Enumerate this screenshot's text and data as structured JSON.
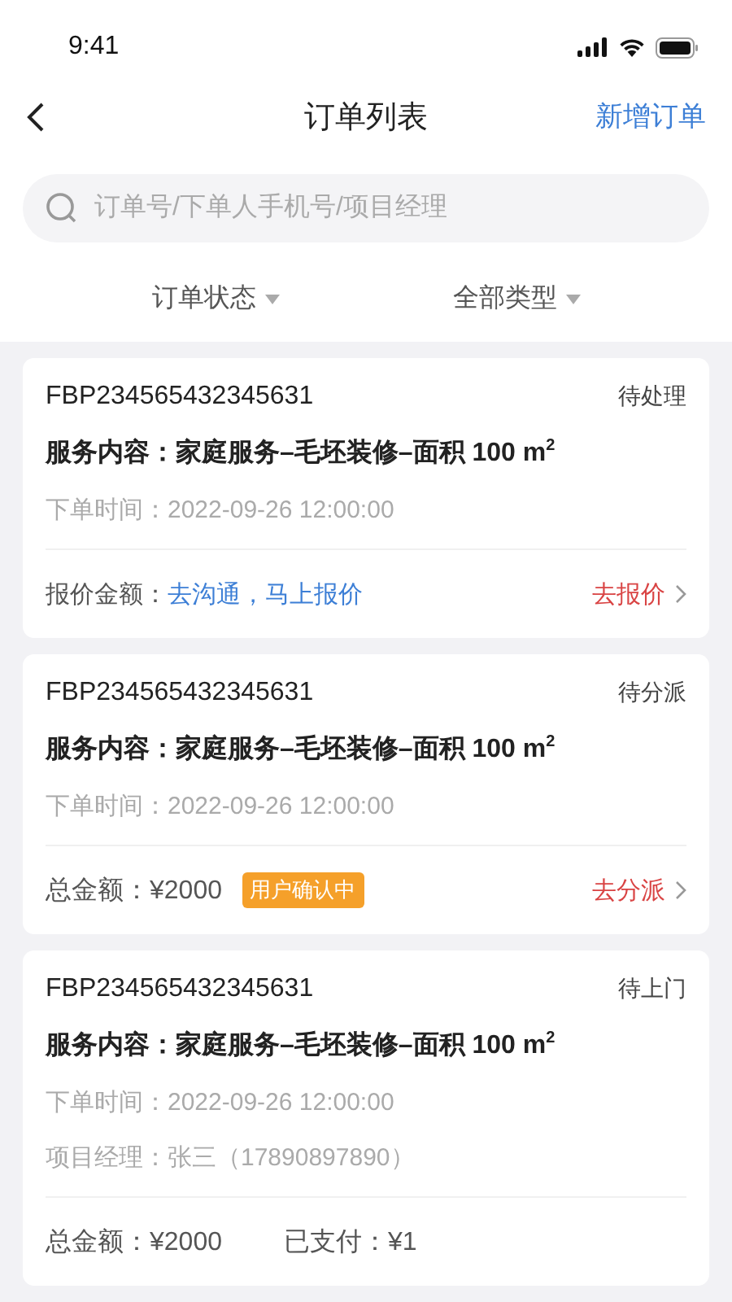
{
  "status_bar": {
    "time": "9:41"
  },
  "nav": {
    "title": "订单列表",
    "action": "新增订单"
  },
  "search": {
    "placeholder": "订单号/下单人手机号/项目经理"
  },
  "filters": [
    {
      "label": "订单状态"
    },
    {
      "label": "全部类型"
    }
  ],
  "orders": [
    {
      "number": "FBP234565432345631",
      "status": "待处理",
      "service": "服务内容：家庭服务–毛坯装修–面积 100 m$^{2}$",
      "details": [
        "下单时间：2022-09-26 12:00:00"
      ],
      "footer": [
        {
          "kind": "label",
          "text": "报价金额："
        },
        {
          "kind": "link",
          "text": "去沟通，马上报价"
        },
        {
          "kind": "action",
          "text": "去报价"
        }
      ]
    },
    {
      "number": "FBP234565432345631",
      "status": "待分派",
      "service": "服务内容：家庭服务–毛坯装修–面积 100 m$^{2}$",
      "details": [
        "下单时间：2022-09-26 12:00:00"
      ],
      "footer": [
        {
          "kind": "amount",
          "text": "总金额：¥2000"
        },
        {
          "kind": "badge",
          "text": "用户确认中"
        },
        {
          "kind": "action",
          "text": "去分派"
        }
      ]
    },
    {
      "number": "FBP234565432345631",
      "status": "待上门",
      "service": "服务内容：家庭服务–毛坯装修–面积 100 m$^{2}$",
      "details": [
        "下单时间：2022-09-26 12:00:00",
        "项目经理：张三（17890897890）"
      ],
      "footer": [
        {
          "kind": "amount",
          "text": "总金额：¥2000"
        },
        {
          "kind": "paid",
          "text": "已支付：¥1"
        }
      ]
    }
  ]
}
